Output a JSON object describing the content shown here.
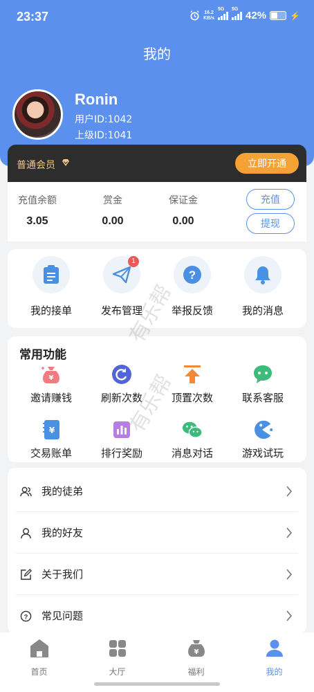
{
  "status_bar": {
    "time": "23:37",
    "net_speed_value": "16.2",
    "net_speed_unit": "KB/s",
    "signal1_tag": "5G",
    "signal2_tag": "5G",
    "battery": "42%"
  },
  "header": {
    "title": "我的"
  },
  "profile": {
    "name": "Ronin",
    "user_id": "用户ID:1042",
    "parent_id": "上级ID:1041"
  },
  "membership": {
    "label": "普通会员",
    "open_button": "立即开通"
  },
  "balances": [
    {
      "label": "充值余额",
      "value": "3.05"
    },
    {
      "label": "赏金",
      "value": "0.00"
    },
    {
      "label": "保证金",
      "value": "0.00"
    }
  ],
  "balance_actions": {
    "recharge": "充值",
    "withdraw": "提现"
  },
  "shortcuts": [
    {
      "label": "我的接单",
      "icon": "clipboard-icon"
    },
    {
      "label": "发布管理",
      "icon": "paper-plane-icon",
      "badge": "1"
    },
    {
      "label": "举报反馈",
      "icon": "question-icon"
    },
    {
      "label": "我的消息",
      "icon": "bell-icon"
    }
  ],
  "common": {
    "title": "常用功能",
    "items": [
      {
        "label": "邀请赚钱",
        "icon": "money-bag-icon"
      },
      {
        "label": "刷新次数",
        "icon": "refresh-icon"
      },
      {
        "label": "顶置次数",
        "icon": "pin-top-icon"
      },
      {
        "label": "联系客服",
        "icon": "chat-bubble-icon"
      },
      {
        "label": "交易账单",
        "icon": "bill-icon"
      },
      {
        "label": "排行奖励",
        "icon": "ranking-icon"
      },
      {
        "label": "消息对话",
        "icon": "wechat-icon"
      },
      {
        "label": "游戏试玩",
        "icon": "game-icon"
      }
    ]
  },
  "menu": [
    {
      "label": "我的徒弟",
      "icon": "users-icon"
    },
    {
      "label": "我的好友",
      "icon": "user-icon"
    },
    {
      "label": "关于我们",
      "icon": "edit-icon"
    },
    {
      "label": "常见问题",
      "icon": "help-icon"
    }
  ],
  "tabs": [
    {
      "label": "首页",
      "icon": "home-icon"
    },
    {
      "label": "大厅",
      "icon": "grid-icon"
    },
    {
      "label": "福利",
      "icon": "gift-icon"
    },
    {
      "label": "我的",
      "icon": "person-icon",
      "active": true
    }
  ],
  "watermark": "有乐帮",
  "colors": {
    "primary": "#5b90ef",
    "vip_bg": "#2d2d2d",
    "vip_button": "#f4a235",
    "badge": "#e85a52"
  }
}
